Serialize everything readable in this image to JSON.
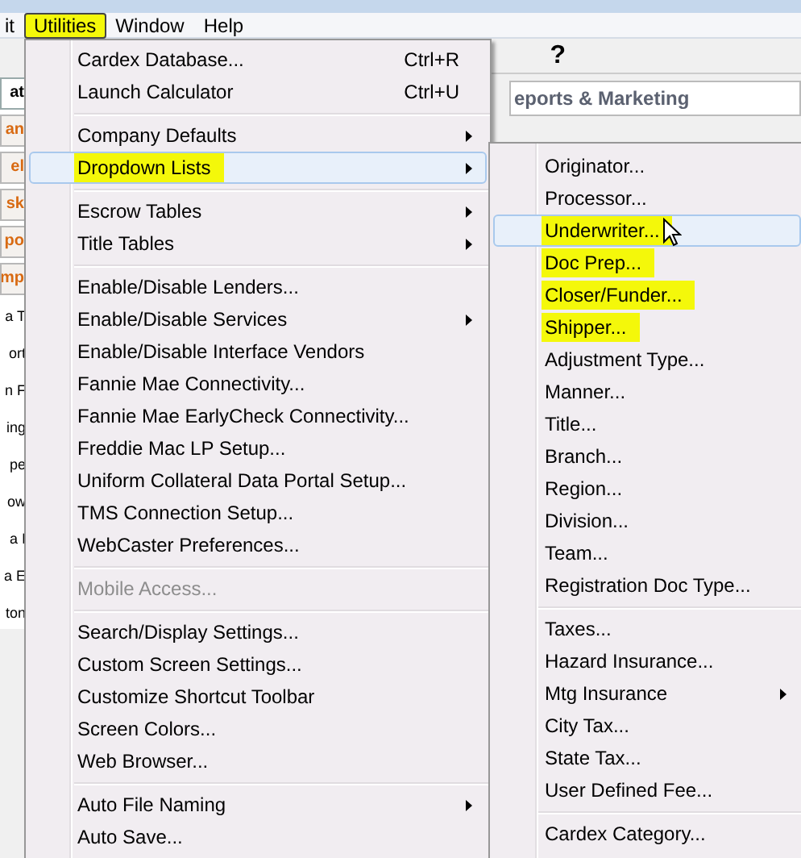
{
  "menubar": [
    {
      "label": "it",
      "highlighted": false,
      "open": false
    },
    {
      "label": "Utilities",
      "highlighted": true,
      "open": true
    },
    {
      "label": "Window",
      "highlighted": false,
      "open": false
    },
    {
      "label": "Help",
      "highlighted": false,
      "open": false
    }
  ],
  "help_button": "?",
  "section_header": "eports & Marketing",
  "side_fragments": [
    {
      "text": "at",
      "kind": "header"
    },
    {
      "text": "an",
      "kind": "tab"
    },
    {
      "text": "el",
      "kind": "tab"
    },
    {
      "text": "sk",
      "kind": "tab"
    },
    {
      "text": "po",
      "kind": "tab"
    },
    {
      "text": "mp",
      "kind": "tab"
    },
    {
      "text": "a T",
      "kind": "text"
    },
    {
      "text": "ort",
      "kind": "text"
    },
    {
      "text": "n F",
      "kind": "text"
    },
    {
      "text": "ing",
      "kind": "text"
    },
    {
      "text": "pe",
      "kind": "text"
    },
    {
      "text": "ow",
      "kind": "text"
    },
    {
      "text": "a I",
      "kind": "text"
    },
    {
      "text": "a E",
      "kind": "text"
    },
    {
      "text": "ton",
      "kind": "text"
    }
  ],
  "utilities_menu": {
    "groups": [
      [
        {
          "label": "Cardex Database...",
          "shortcut": "Ctrl+R",
          "submenu": false,
          "disabled": false,
          "selected": false,
          "highlighted": false
        },
        {
          "label": "Launch Calculator",
          "shortcut": "Ctrl+U",
          "submenu": false,
          "disabled": false,
          "selected": false,
          "highlighted": false
        }
      ],
      [
        {
          "label": "Company Defaults",
          "submenu": true,
          "disabled": false,
          "selected": false,
          "highlighted": false
        },
        {
          "label": "Dropdown Lists",
          "submenu": true,
          "disabled": false,
          "selected": true,
          "highlighted": true
        }
      ],
      [
        {
          "label": "Escrow Tables",
          "submenu": true,
          "disabled": false,
          "selected": false,
          "highlighted": false
        },
        {
          "label": "Title Tables",
          "submenu": true,
          "disabled": false,
          "selected": false,
          "highlighted": false
        }
      ],
      [
        {
          "label": "Enable/Disable Lenders...",
          "submenu": false,
          "disabled": false,
          "selected": false,
          "highlighted": false
        },
        {
          "label": "Enable/Disable Services",
          "submenu": true,
          "disabled": false,
          "selected": false,
          "highlighted": false
        },
        {
          "label": "Enable/Disable Interface Vendors",
          "submenu": false,
          "disabled": false,
          "selected": false,
          "highlighted": false
        },
        {
          "label": "Fannie Mae Connectivity...",
          "submenu": false,
          "disabled": false,
          "selected": false,
          "highlighted": false
        },
        {
          "label": "Fannie Mae EarlyCheck Connectivity...",
          "submenu": false,
          "disabled": false,
          "selected": false,
          "highlighted": false
        },
        {
          "label": "Freddie Mac LP Setup...",
          "submenu": false,
          "disabled": false,
          "selected": false,
          "highlighted": false
        },
        {
          "label": "Uniform Collateral Data Portal Setup...",
          "submenu": false,
          "disabled": false,
          "selected": false,
          "highlighted": false
        },
        {
          "label": "TMS Connection Setup...",
          "submenu": false,
          "disabled": false,
          "selected": false,
          "highlighted": false
        },
        {
          "label": "WebCaster Preferences...",
          "submenu": false,
          "disabled": false,
          "selected": false,
          "highlighted": false
        }
      ],
      [
        {
          "label": "Mobile Access...",
          "submenu": false,
          "disabled": true,
          "selected": false,
          "highlighted": false
        }
      ],
      [
        {
          "label": "Search/Display Settings...",
          "submenu": false,
          "disabled": false,
          "selected": false,
          "highlighted": false
        },
        {
          "label": "Custom Screen Settings...",
          "submenu": false,
          "disabled": false,
          "selected": false,
          "highlighted": false
        },
        {
          "label": "Customize Shortcut Toolbar",
          "submenu": false,
          "disabled": false,
          "selected": false,
          "highlighted": false
        },
        {
          "label": "Screen Colors...",
          "submenu": false,
          "disabled": false,
          "selected": false,
          "highlighted": false
        },
        {
          "label": "Web Browser...",
          "submenu": false,
          "disabled": false,
          "selected": false,
          "highlighted": false
        }
      ],
      [
        {
          "label": "Auto File Naming",
          "submenu": true,
          "disabled": false,
          "selected": false,
          "highlighted": false
        },
        {
          "label": "Auto Save...",
          "submenu": false,
          "disabled": false,
          "selected": false,
          "highlighted": false
        }
      ]
    ]
  },
  "dropdown_lists_menu": {
    "groups": [
      [
        {
          "label": "Originator...",
          "submenu": false,
          "disabled": false,
          "selected": false,
          "highlighted": false
        },
        {
          "label": "Processor...",
          "submenu": false,
          "disabled": false,
          "selected": false,
          "highlighted": false
        },
        {
          "label": "Underwriter...",
          "submenu": false,
          "disabled": false,
          "selected": true,
          "highlighted": true
        },
        {
          "label": "Doc Prep...",
          "submenu": false,
          "disabled": false,
          "selected": false,
          "highlighted": true
        },
        {
          "label": "Closer/Funder...",
          "submenu": false,
          "disabled": false,
          "selected": false,
          "highlighted": true
        },
        {
          "label": "Shipper...",
          "submenu": false,
          "disabled": false,
          "selected": false,
          "highlighted": true
        },
        {
          "label": "Adjustment Type...",
          "submenu": false,
          "disabled": false,
          "selected": false,
          "highlighted": false
        },
        {
          "label": "Manner...",
          "submenu": false,
          "disabled": false,
          "selected": false,
          "highlighted": false
        },
        {
          "label": "Title...",
          "submenu": false,
          "disabled": false,
          "selected": false,
          "highlighted": false
        },
        {
          "label": "Branch...",
          "submenu": false,
          "disabled": false,
          "selected": false,
          "highlighted": false
        },
        {
          "label": "Region...",
          "submenu": false,
          "disabled": false,
          "selected": false,
          "highlighted": false
        },
        {
          "label": "Division...",
          "submenu": false,
          "disabled": false,
          "selected": false,
          "highlighted": false
        },
        {
          "label": "Team...",
          "submenu": false,
          "disabled": false,
          "selected": false,
          "highlighted": false
        },
        {
          "label": "Registration Doc Type...",
          "submenu": false,
          "disabled": false,
          "selected": false,
          "highlighted": false
        }
      ],
      [
        {
          "label": "Taxes...",
          "submenu": false,
          "disabled": false,
          "selected": false,
          "highlighted": false
        },
        {
          "label": "Hazard Insurance...",
          "submenu": false,
          "disabled": false,
          "selected": false,
          "highlighted": false
        },
        {
          "label": "Mtg Insurance",
          "submenu": true,
          "disabled": false,
          "selected": false,
          "highlighted": false
        },
        {
          "label": "City Tax...",
          "submenu": false,
          "disabled": false,
          "selected": false,
          "highlighted": false
        },
        {
          "label": "State Tax...",
          "submenu": false,
          "disabled": false,
          "selected": false,
          "highlighted": false
        },
        {
          "label": "User Defined Fee...",
          "submenu": false,
          "disabled": false,
          "selected": false,
          "highlighted": false
        }
      ],
      [
        {
          "label": "Cardex Category...",
          "submenu": false,
          "disabled": false,
          "selected": false,
          "highlighted": false
        }
      ]
    ]
  }
}
